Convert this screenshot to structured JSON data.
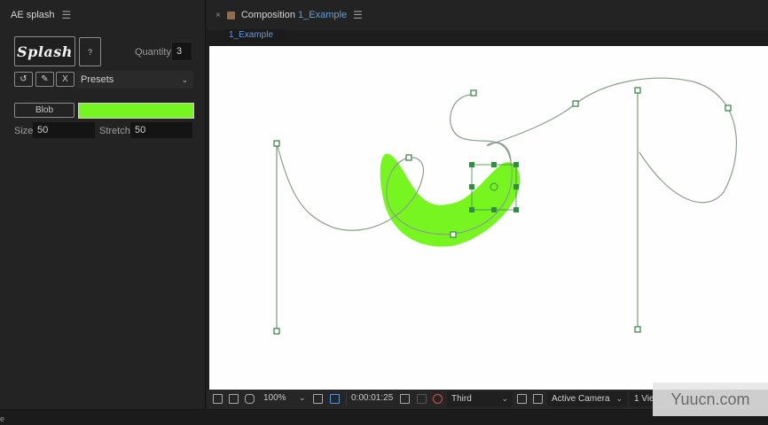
{
  "panel": {
    "title": "AE splash",
    "menu_icon": "hamburger-icon",
    "logo_text": "Splash",
    "help_label": "?",
    "quantity_label": "Quantity",
    "quantity_value": "3",
    "tools": [
      {
        "name": "refresh-icon",
        "glyph": "↺"
      },
      {
        "name": "pencil-icon",
        "glyph": "✎"
      },
      {
        "name": "close-icon",
        "glyph": "X"
      }
    ],
    "presets_label": "Presets",
    "blob_label": "Blob",
    "blob_color": "#77f520",
    "size_label": "Size",
    "size_value": "50",
    "stretch_label": "Stretch",
    "stretch_value": "50"
  },
  "composition": {
    "close_glyph": "×",
    "title_prefix": "Composition",
    "title_name": "1_Example",
    "sub_tab": "1_Example"
  },
  "toolbar": {
    "zoom": "100%",
    "timecode": "0:00:01:25",
    "resolution": "Third",
    "camera": "Active Camera",
    "views": "1 Vie"
  },
  "watermark": "Yuucn.com",
  "edge_char": "e",
  "colors": {
    "path_stroke": "#6f8f6f",
    "handle_stroke": "#3f8a4f",
    "blob_fill": "#77f520",
    "selected_handle": "#2f8f3f"
  }
}
